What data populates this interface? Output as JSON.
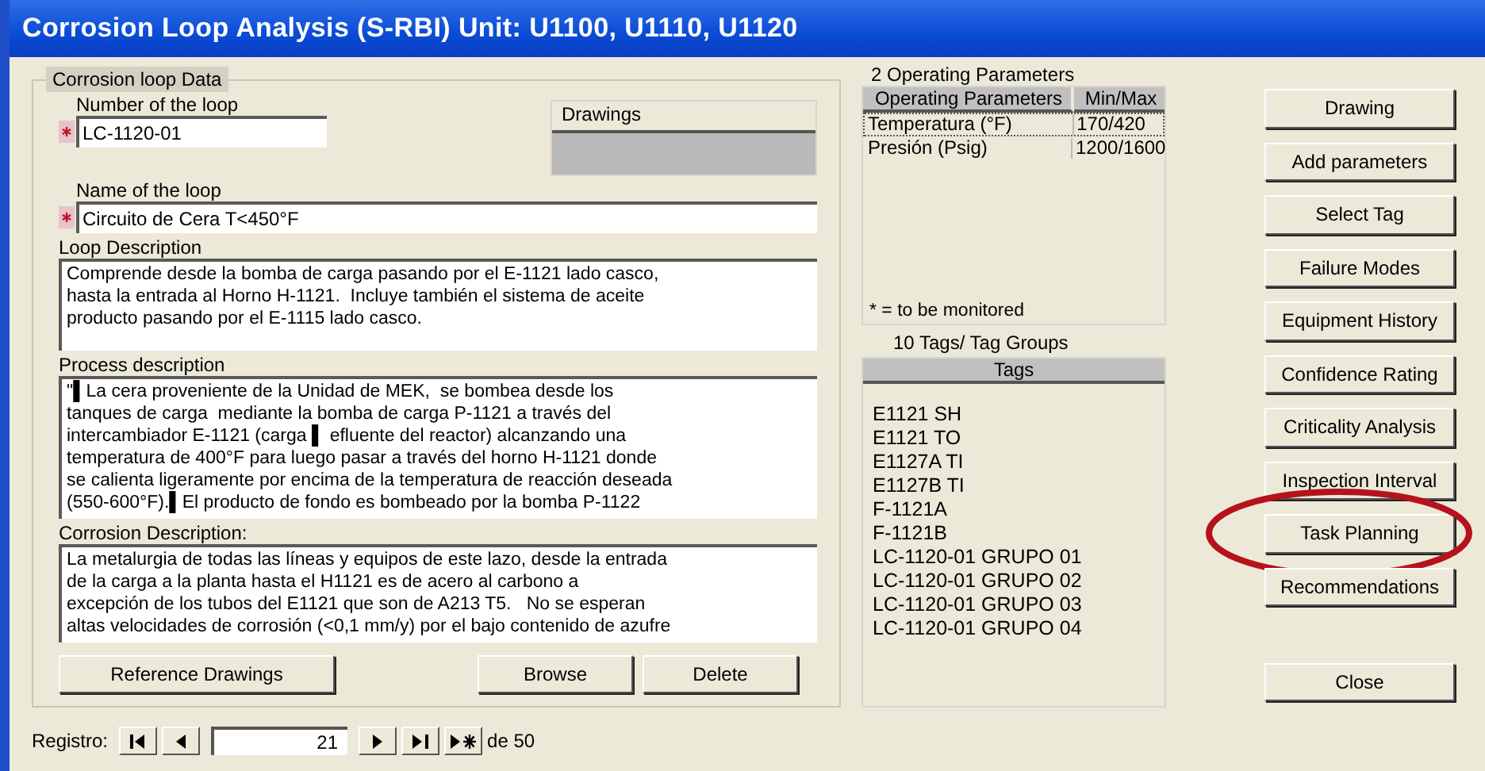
{
  "window": {
    "title": "Corrosion Loop Analysis (S-RBI) Unit: U1100, U1110, U1120"
  },
  "loop_data": {
    "legend": "Corrosion loop Data",
    "number": {
      "label": "Number of the loop",
      "value": "LC-1120-01",
      "required": true
    },
    "drawings": {
      "header": "Drawings"
    },
    "name": {
      "label": "Name of the loop",
      "value": "Circuito de Cera T<450°F",
      "required": true
    },
    "loop_description": {
      "label": "Loop Description",
      "value": "Comprende desde la bomba de carga pasando por el E-1121 lado casco,\nhasta la entrada al Horno H-1121.  Incluye también el sistema de aceite\nproducto pasando por el E-1115 lado casco."
    },
    "process_description": {
      "label": "Process description",
      "value": "\"▌La cera proveniente de la Unidad de MEK,  se bombea desde los\ntanques de carga  mediante la bomba de carga P-1121 a través del\nintercambiador E-1121 (carga ▌ efluente del reactor) alcanzando una\ntemperatura de 400°F para luego pasar a través del horno H-1121 donde\nse calienta ligeramente por encima de la temperatura de reacción deseada\n(550-600°F).▌El producto de fondo es bombeado por la bomba P-1122"
    },
    "corrosion_description": {
      "label": "Corrosion Description:",
      "value": "La metalurgia de todas las líneas y equipos de este lazo, desde la entrada\nde la carga a la planta hasta el H1121 es de acero al carbono a\nexcepción de los tubos del E1121 que son de A213 T5.   No se esperan\naltas velocidades de corrosión (<0,1 mm/y) por el bajo contenido de azufre"
    },
    "buttons": [
      {
        "label": "Reference Drawings"
      },
      {
        "label": "Browse"
      },
      {
        "label": "Delete"
      }
    ]
  },
  "operating_parameters": {
    "caption": "2 Operating Parameters",
    "columns": [
      "Operating Parameters",
      "Min/Max"
    ],
    "rows": [
      {
        "cells": [
          "Temperatura (°F)",
          "170/420"
        ],
        "focused": true
      },
      {
        "cells": [
          "Presión (Psig)",
          "1200/1600"
        ],
        "focused": false
      }
    ],
    "footnote": "* = to be monitored"
  },
  "tags": {
    "caption": "10  Tags/ Tag Groups",
    "header": "Tags",
    "items": [
      "E1121 SH",
      "E1121 TO",
      "E1127A TI",
      "E1127B TI",
      "F-1121A",
      "F-1121B",
      "LC-1120-01 GRUPO 01",
      "LC-1120-01 GRUPO 02",
      "LC-1120-01 GRUPO 03",
      "LC-1120-01 GRUPO 04"
    ]
  },
  "side_buttons": [
    {
      "label": "Drawing",
      "highlighted": false
    },
    {
      "label": "Add parameters",
      "highlighted": false
    },
    {
      "label": "Select Tag",
      "highlighted": false
    },
    {
      "label": "Failure Modes",
      "highlighted": false
    },
    {
      "label": "Equipment History",
      "highlighted": false
    },
    {
      "label": "Confidence Rating",
      "highlighted": false
    },
    {
      "label": "Criticality Analysis",
      "highlighted": false
    },
    {
      "label": "Inspection Interval",
      "highlighted": false
    },
    {
      "label": "Task Planning",
      "highlighted": true
    },
    {
      "label": "Recommendations",
      "highlighted": false
    }
  ],
  "close_button": {
    "label": "Close"
  },
  "record_navigator": {
    "label": "Registro:",
    "current": "21",
    "total": "de  50"
  }
}
